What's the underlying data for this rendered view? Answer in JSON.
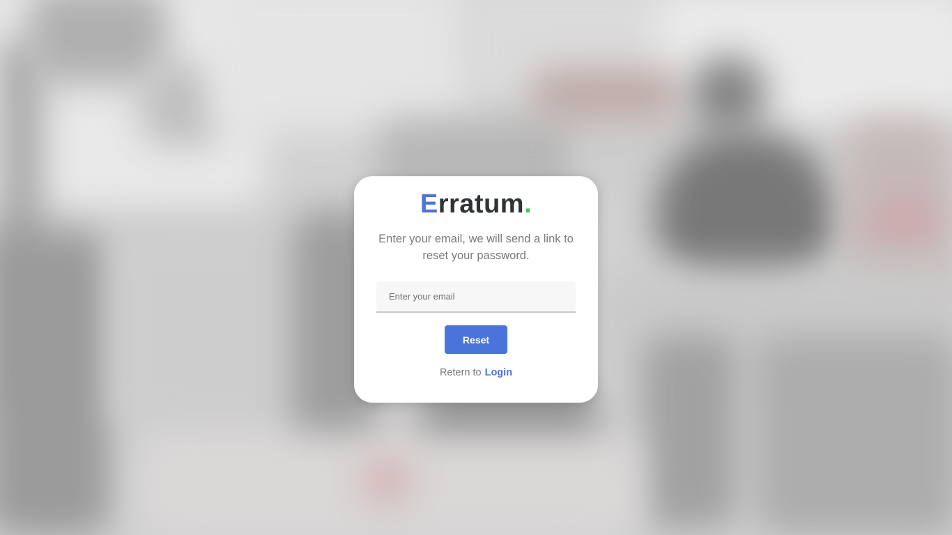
{
  "brand": {
    "first_letter": "E",
    "rest": "rratum",
    "dot": ".",
    "accent_color": "#4a74d9",
    "dot_color": "#4cc05f"
  },
  "subtitle": "Enter your email, we will send a link to reset your password.",
  "email_field": {
    "placeholder": "Enter your email",
    "value": ""
  },
  "reset_button": {
    "label": "Reset",
    "color": "#4a74d9"
  },
  "return_line": {
    "prefix": "Retern to",
    "link_label": "Login"
  },
  "background": {
    "description_color": "#d6d6d6"
  }
}
